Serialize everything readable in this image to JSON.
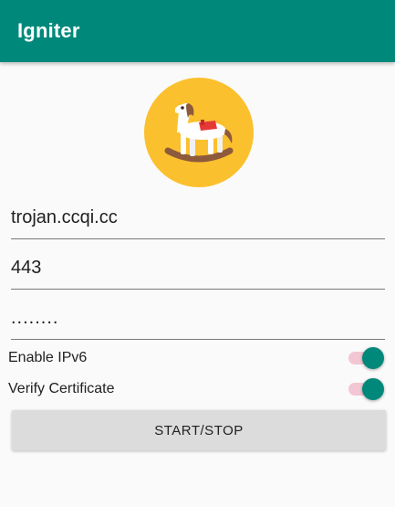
{
  "app_bar": {
    "title": "Igniter",
    "color": "#00897b"
  },
  "logo": {
    "icon": "rocking-horse-icon",
    "background_color": "#fbc02d"
  },
  "form": {
    "host": {
      "value": "trojan.ccqi.cc"
    },
    "port": {
      "value": "443"
    },
    "password": {
      "value": "........"
    }
  },
  "options": {
    "ipv6": {
      "label": "Enable IPv6",
      "checked": true
    },
    "verify_cert": {
      "label": "Verify Certificate",
      "checked": true
    }
  },
  "actions": {
    "start_stop_label": "START/STOP"
  },
  "colors": {
    "accent": "#00897b",
    "switch_track": "#f3c6d3",
    "button_bg": "#dcdcdc"
  }
}
